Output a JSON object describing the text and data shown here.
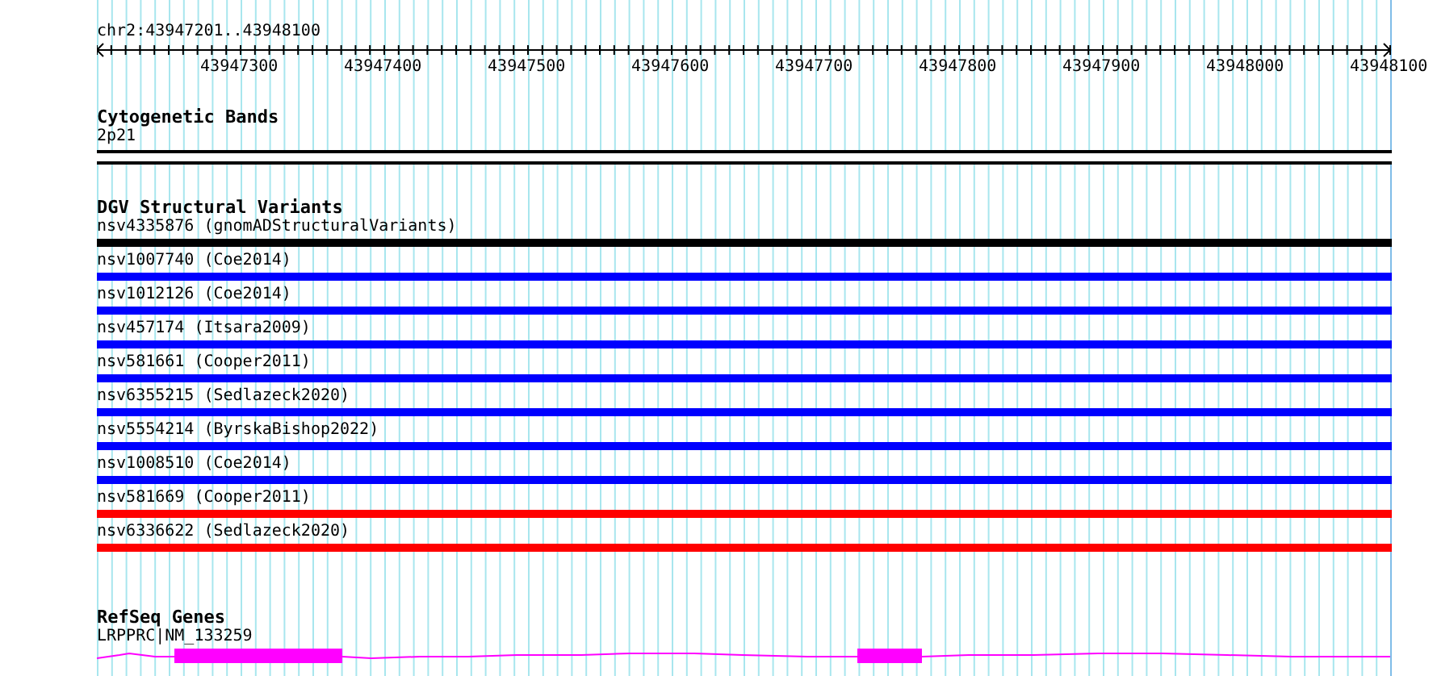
{
  "region": "chr2:43947201..43948100",
  "ruler": {
    "tick_labels": [
      "43947300",
      "43947400",
      "43947500",
      "43947600",
      "43947700",
      "43947800",
      "43947900",
      "43948000",
      "43948100"
    ]
  },
  "cytogenetic_bands": {
    "title": "Cytogenetic Bands",
    "band": "2p21"
  },
  "dgv": {
    "title": "DGV Structural Variants",
    "variants": [
      {
        "label": "nsv4335876 (gnomADStructuralVariants)",
        "color": "#000000"
      },
      {
        "label": "nsv1007740 (Coe2014)",
        "color": "#0000ff"
      },
      {
        "label": "nsv1012126 (Coe2014)",
        "color": "#0000ff"
      },
      {
        "label": "nsv457174 (Itsara2009)",
        "color": "#0000ff"
      },
      {
        "label": "nsv581661 (Cooper2011)",
        "color": "#0000ff"
      },
      {
        "label": "nsv6355215 (Sedlazeck2020)",
        "color": "#0000ff"
      },
      {
        "label": "nsv5554214 (ByrskaBishop2022)",
        "color": "#0000ff"
      },
      {
        "label": "nsv1008510 (Coe2014)",
        "color": "#0000ff"
      },
      {
        "label": "nsv581669 (Cooper2011)",
        "color": "#ff0000"
      },
      {
        "label": "nsv6336622 (Sedlazeck2020)",
        "color": "#ff0000"
      }
    ]
  },
  "refseq": {
    "title": "RefSeq Genes",
    "gene": "LRPPRC|NM_133259"
  }
}
